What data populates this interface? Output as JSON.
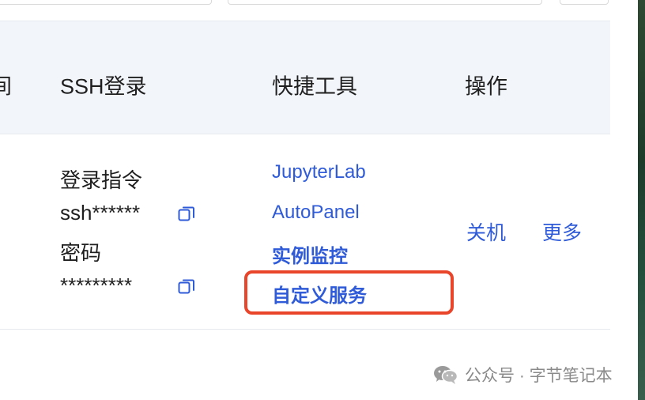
{
  "table": {
    "headers": {
      "cut": "间",
      "ssh": "SSH登录",
      "tools": "快捷工具",
      "ops": "操作"
    }
  },
  "row": {
    "ssh": {
      "login_label": "登录指令",
      "login_value": "ssh******",
      "password_label": "密码",
      "password_value": "*********"
    },
    "tools": [
      "JupyterLab",
      "AutoPanel",
      "实例监控",
      "自定义服务"
    ],
    "ops": {
      "shutdown": "关机",
      "more": "更多"
    }
  },
  "watermark": {
    "text": "公众号 · 字节笔记本"
  },
  "colors": {
    "link": "#2f5bd8",
    "highlight": "#e8452b",
    "header_bg": "#f2f5fa"
  }
}
